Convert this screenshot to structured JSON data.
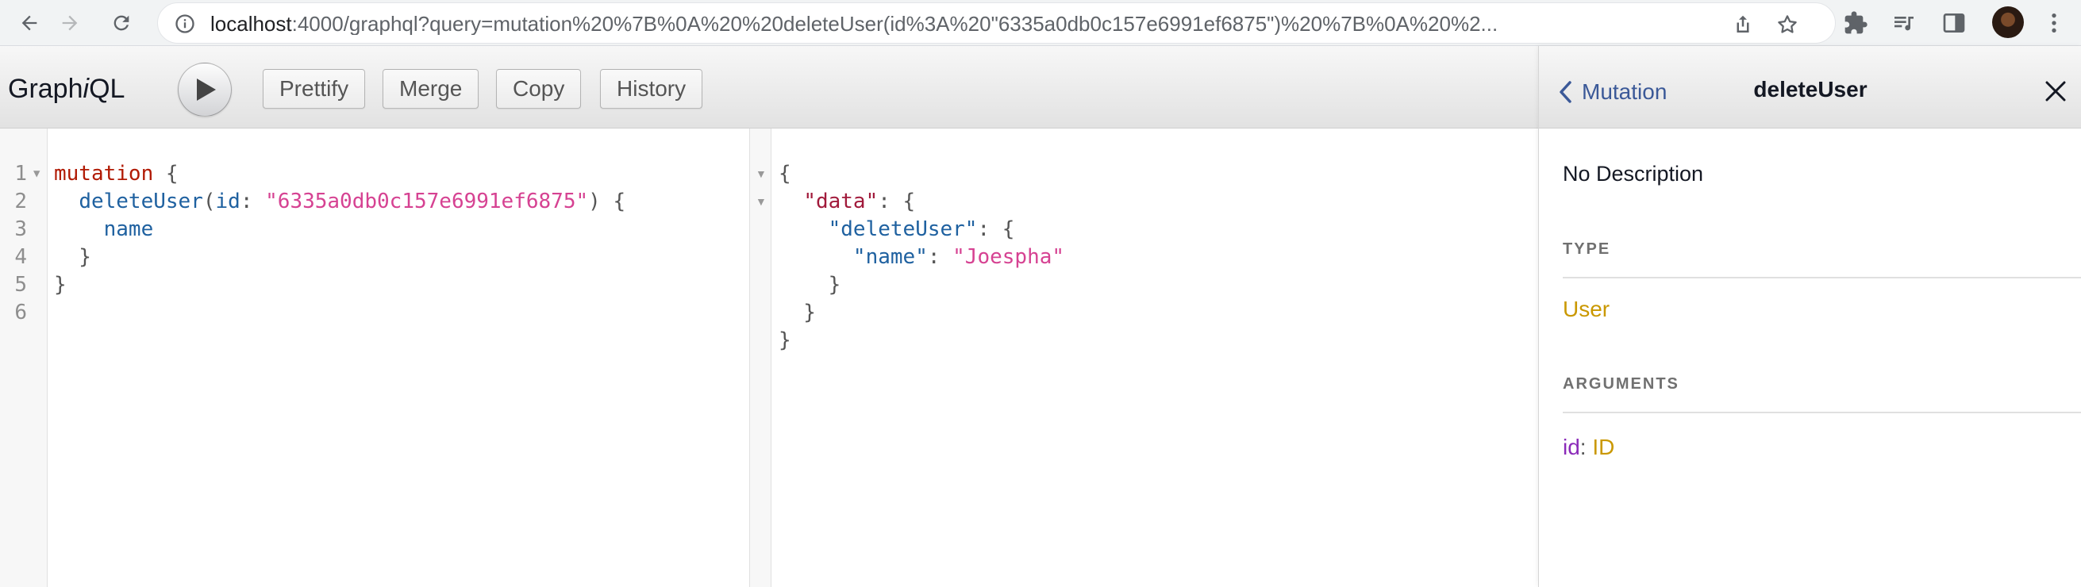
{
  "browser": {
    "url_host": "localhost",
    "url_rest": ":4000/graphql?query=mutation%20%7B%0A%20%20deleteUser(id%3A%20\"6335a0db0c157e6991ef6875\")%20%7B%0A%20%2..."
  },
  "toolbar": {
    "logo_prefix": "Graph",
    "logo_i": "i",
    "logo_suffix": "QL",
    "prettify_label": "Prettify",
    "merge_label": "Merge",
    "copy_label": "Copy",
    "history_label": "History"
  },
  "query_editor": {
    "line_numbers": [
      "1",
      "2",
      "3",
      "4",
      "5",
      "6"
    ],
    "keyword": "mutation",
    "field": "deleteUser",
    "arg_name": "id",
    "arg_value": "\"6335a0db0c157e6991ef6875\"",
    "selection": "name"
  },
  "result": {
    "data_key": "\"data\"",
    "field_key": "\"deleteUser\"",
    "name_key": "\"name\"",
    "name_value": "\"Joespha\""
  },
  "docs": {
    "back_label": "Mutation",
    "title": "deleteUser",
    "description": "No Description",
    "type_heading": "TYPE",
    "type_name": "User",
    "arguments_heading": "ARGUMENTS",
    "arg_name": "id",
    "arg_type": "ID"
  },
  "colors": {
    "keyword": "#b11a04",
    "field": "#1f61a0",
    "string": "#d64292",
    "type": "#ca9800",
    "argument": "#8b2bb9",
    "link": "#3b5998"
  },
  "icons": [
    "back-arrow-icon",
    "forward-arrow-icon",
    "reload-icon",
    "site-info-icon",
    "share-icon",
    "bookmark-star-icon",
    "extensions-icon",
    "media-control-icon",
    "side-panel-icon",
    "menu-dots-icon",
    "play-icon",
    "chevron-left-icon",
    "close-icon",
    "fold-arrow-icon"
  ]
}
